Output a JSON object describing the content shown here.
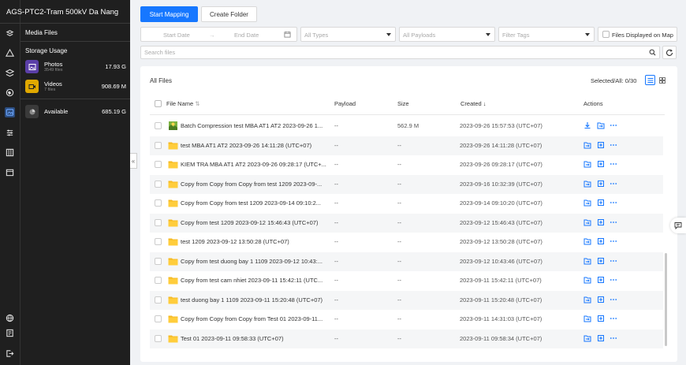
{
  "project_title": "AGS-PTC2-Tram 500kV Da Nang",
  "panel": {
    "media_files": "Media Files",
    "storage_usage": "Storage Usage",
    "photos": {
      "name": "Photos",
      "count": "3549 files",
      "size": "17.93 G",
      "color": "#5b3fa8"
    },
    "videos": {
      "name": "Videos",
      "count": "7 files",
      "size": "908.69 M",
      "color": "#e0a800"
    },
    "available": {
      "name": "Available",
      "size": "685.19 G"
    }
  },
  "rail_icons": [
    "layers-alt-icon",
    "flight-icon",
    "layers-icon",
    "globe-icon",
    "media-icon",
    "equalizer-icon",
    "grid-icon",
    "calendar-icon",
    "language-icon",
    "report-icon",
    "logout-icon"
  ],
  "toolbar": {
    "start_mapping": "Start Mapping",
    "create_folder": "Create Folder"
  },
  "filters": {
    "start_date": "Start Date",
    "end_date": "End Date",
    "types": "All Types",
    "payloads": "All Payloads",
    "tags": "Filter Tags",
    "map_label": "Files Displayed on Map"
  },
  "search": {
    "placeholder": "Search files"
  },
  "list": {
    "title": "All Files",
    "selected": "Selected/All: 0/30",
    "columns": {
      "name": "File Name",
      "payload": "Payload",
      "size": "Size",
      "created": "Created",
      "actions": "Actions"
    },
    "rows": [
      {
        "name": "Batch Compression test MBA AT1 AT2 2023-09-26 1...",
        "payload": "--",
        "size": "562.9 M",
        "created": "2023-09-26 15:57:53 (UTC+07)",
        "type": "image"
      },
      {
        "name": "test MBA AT1 AT2 2023-09-26 14:11:28 (UTC+07)",
        "payload": "--",
        "size": "--",
        "created": "2023-09-26 14:11:28 (UTC+07)",
        "type": "folder"
      },
      {
        "name": "KIEM TRA MBA AT1 AT2 2023-09-26 09:28:17 (UTC+...",
        "payload": "--",
        "size": "--",
        "created": "2023-09-26 09:28:17 (UTC+07)",
        "type": "folder"
      },
      {
        "name": "Copy from Copy from Copy from test 1209 2023-09-...",
        "payload": "--",
        "size": "--",
        "created": "2023-09-16 10:32:39 (UTC+07)",
        "type": "folder"
      },
      {
        "name": "Copy from Copy from test 1209 2023-09-14 09:10:2...",
        "payload": "--",
        "size": "--",
        "created": "2023-09-14 09:10:20 (UTC+07)",
        "type": "folder"
      },
      {
        "name": "Copy from test 1209 2023-09-12 15:46:43 (UTC+07)",
        "payload": "--",
        "size": "--",
        "created": "2023-09-12 15:46:43 (UTC+07)",
        "type": "folder"
      },
      {
        "name": "test 1209 2023-09-12 13:50:28 (UTC+07)",
        "payload": "--",
        "size": "--",
        "created": "2023-09-12 13:50:28 (UTC+07)",
        "type": "folder"
      },
      {
        "name": "Copy from test duong bay 1 1109 2023-09-12 10:43:...",
        "payload": "--",
        "size": "--",
        "created": "2023-09-12 10:43:46 (UTC+07)",
        "type": "folder"
      },
      {
        "name": "Copy from test cam nhiet 2023-09-11 15:42:11 (UTC...",
        "payload": "--",
        "size": "--",
        "created": "2023-09-11 15:42:11 (UTC+07)",
        "type": "folder"
      },
      {
        "name": "test duong bay 1 1109 2023-09-11 15:20:48 (UTC+07)",
        "payload": "--",
        "size": "--",
        "created": "2023-09-11 15:20:48 (UTC+07)",
        "type": "folder"
      },
      {
        "name": "Copy from Copy from Copy from Test 01 2023-09-11...",
        "payload": "--",
        "size": "--",
        "created": "2023-09-11 14:31:03 (UTC+07)",
        "type": "folder"
      },
      {
        "name": "Test 01 2023-09-11 09:58:33 (UTC+07)",
        "payload": "--",
        "size": "--",
        "created": "2023-09-11 09:58:34 (UTC+07)",
        "type": "folder"
      }
    ]
  },
  "colors": {
    "accent": "#1677ff",
    "folder": "#f5b922",
    "sidebar": "#1f1f1f"
  }
}
